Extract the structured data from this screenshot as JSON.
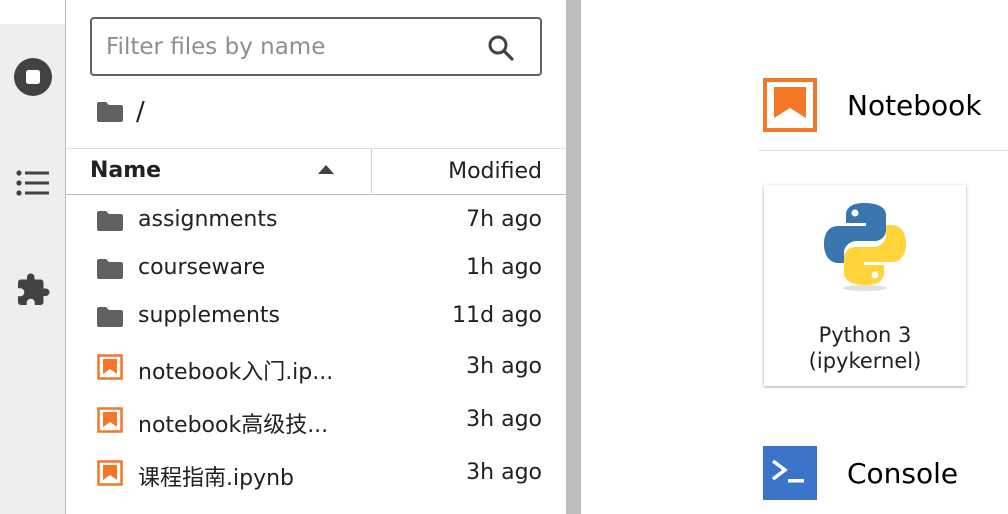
{
  "sidebar": {
    "icons": [
      {
        "name": "stop-circle-icon",
        "label": "Running Terminals and Kernels"
      },
      {
        "name": "list-icon",
        "label": "Table of Contents"
      },
      {
        "name": "extension-icon",
        "label": "Extension Manager"
      }
    ],
    "icon_color": "#424242"
  },
  "file_browser": {
    "search": {
      "placeholder": "Filter files by name",
      "value": ""
    },
    "breadcrumb": "/",
    "header": {
      "name": "Name",
      "modified": "Modified"
    },
    "items": [
      {
        "name": "assignments",
        "modified": "7h ago",
        "type": "folder"
      },
      {
        "name": "courseware",
        "modified": "1h ago",
        "type": "folder"
      },
      {
        "name": "supplements",
        "modified": "11d ago",
        "type": "folder"
      },
      {
        "name": "notebook入门.ip...",
        "modified": "3h ago",
        "type": "notebook"
      },
      {
        "name": "notebook高级技...",
        "modified": "3h ago",
        "type": "notebook"
      },
      {
        "name": "课程指南.ipynb",
        "modified": "3h ago",
        "type": "notebook"
      }
    ],
    "folder_color": "#616161",
    "notebook_color": "#f37726"
  },
  "launcher": {
    "notebook_section": {
      "title": "Notebook",
      "icon": "notebook-icon",
      "color": "#f37726"
    },
    "kernel_card": {
      "label_line1": "Python 3",
      "label_line2": "(ipykernel)",
      "icon": "python-logo-icon"
    },
    "console_section": {
      "title": "Console",
      "icon": "console-icon",
      "color": "#3b73c9"
    }
  }
}
